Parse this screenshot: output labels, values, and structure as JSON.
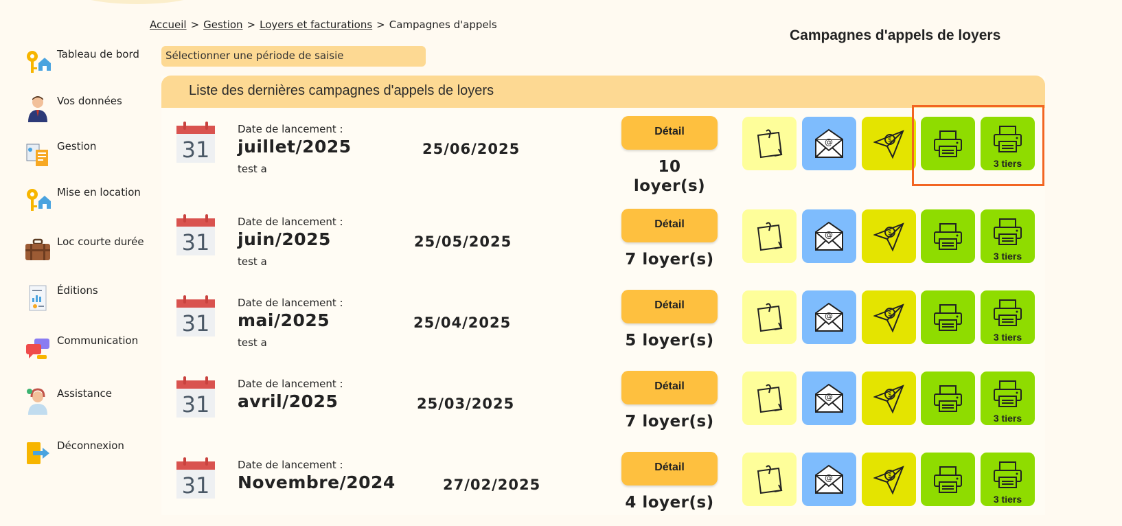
{
  "breadcrumb": {
    "items": [
      "Accueil",
      "Gestion",
      "Loyers et facturations"
    ],
    "current": "Campagnes d'appels",
    "separator": ">"
  },
  "page_title": "Campagnes d'appels de loyers",
  "period_select": {
    "label": "Sélectionner une période de saisie"
  },
  "list_title": "Liste des dernières campagnes d'appels de loyers",
  "sidebar": {
    "items": [
      {
        "label": "Tableau de bord",
        "icon": "keys-house-icon"
      },
      {
        "label": "Vos données",
        "icon": "user-avatar-icon"
      },
      {
        "label": "Gestion",
        "icon": "documents-icon"
      },
      {
        "label": "Mise en location",
        "icon": "keys-house-icon"
      },
      {
        "label": "Loc courte durée",
        "icon": "suitcase-icon"
      },
      {
        "label": "Éditions",
        "icon": "report-icon"
      },
      {
        "label": "Communication",
        "icon": "chat-bubbles-icon"
      },
      {
        "label": "Assistance",
        "icon": "support-agent-icon"
      },
      {
        "label": "Déconnexion",
        "icon": "logout-icon"
      }
    ]
  },
  "campaigns": [
    {
      "launch_label": "Date de lancement :",
      "month": "juillet/2025",
      "note": "test a",
      "date": "25/06/2025",
      "detail_label": "Détail",
      "count_line1": "10",
      "count_line2": "loyer(s)"
    },
    {
      "launch_label": "Date de lancement :",
      "month": "juin/2025",
      "note": "test a",
      "date": "25/05/2025",
      "detail_label": "Détail",
      "count_line1": "7 loyer(s)",
      "count_line2": ""
    },
    {
      "launch_label": "Date de lancement :",
      "month": "mai/2025",
      "note": "test a",
      "date": "25/04/2025",
      "detail_label": "Détail",
      "count_line1": "5 loyer(s)",
      "count_line2": ""
    },
    {
      "launch_label": "Date de lancement :",
      "month": "avril/2025",
      "note": "",
      "date": "25/03/2025",
      "detail_label": "Détail",
      "count_line1": "7 loyer(s)",
      "count_line2": ""
    },
    {
      "launch_label": "Date de lancement :",
      "month": "Novembre/2024",
      "note": "",
      "date": "27/02/2025",
      "detail_label": "Détail",
      "count_line1": "4 loyer(s)",
      "count_line2": ""
    }
  ],
  "calendar_day": "31",
  "actions": {
    "tiers_label": "3 tiers",
    "icons": [
      "sticky-note-icon",
      "email-icon",
      "paper-plane-icon",
      "printer-icon",
      "printer-icon"
    ]
  },
  "colors": {
    "background": "#fffaf1",
    "header_band": "#fdd993",
    "detail_button": "#fec03f",
    "note_button": "#fefe9a",
    "mail_button": "#7ebcfd",
    "send_button": "#e4e400",
    "print_button": "#8fdc00",
    "highlight_border": "#f26522"
  }
}
